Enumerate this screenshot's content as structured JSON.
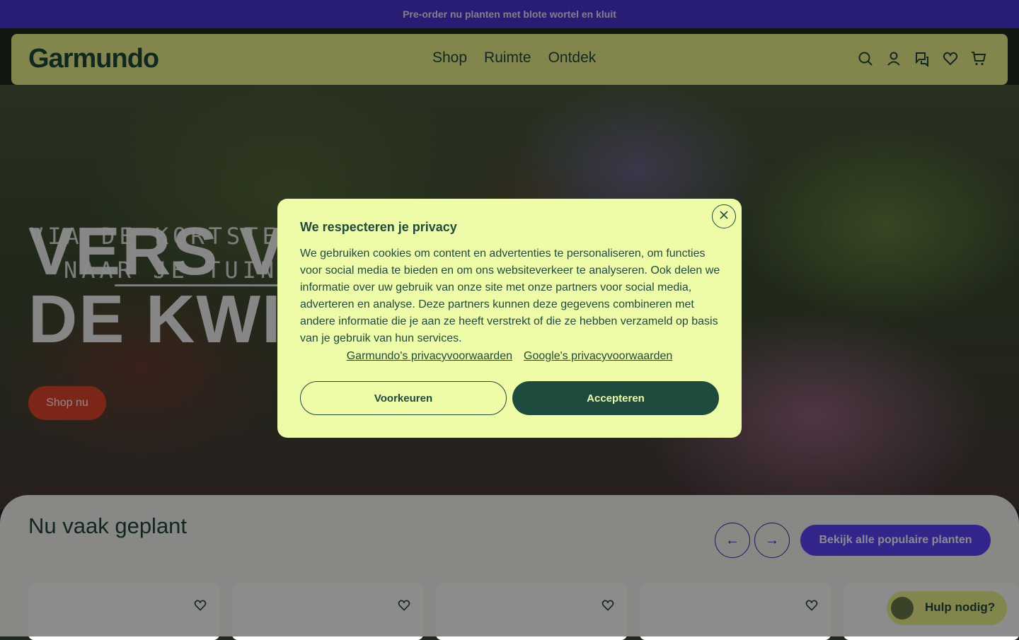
{
  "topbar": {
    "text": "Pre-order nu planten met blote wortel en kluit"
  },
  "header": {
    "logo": "Garmundo",
    "nav": [
      "Shop",
      "Ruimte",
      "Ontdek"
    ],
    "icons": [
      "search-icon",
      "account-icon",
      "chat-icon",
      "heart-icon",
      "cart-icon"
    ]
  },
  "hero": {
    "tagline_line1": "VIA DE KORTSTE WEG",
    "tagline_line2": "NAAR JE TUIN",
    "headline_line1": "VERS V",
    "headline_line2": "DE KWI",
    "cta": "Shop nu"
  },
  "section": {
    "title": "Nu vaak geplant",
    "prev_icon": "arrow-left-icon",
    "next_icon": "arrow-right-icon",
    "all_button": "Bekijk alle populaire planten"
  },
  "help": {
    "label": "Hulp nodig?"
  },
  "modal": {
    "title": "We respecteren je privacy",
    "body": "We gebruiken cookies om content en advertenties te personaliseren, om functies voor social media te bieden en om ons websiteverkeer te analyseren. Ook delen we informatie over uw gebruik van onze site met onze partners voor social media, adverteren en analyse. Deze partners kunnen deze gegevens combineren met andere informatie die je aan ze heeft verstrekt of die ze hebben verzameld op basis van je gebruik van hun services.",
    "link1": "Garmundo's privacyvoorwaarden",
    "link2": "Google's privacyvoorwaarden",
    "btn_preferences": "Voorkeuren",
    "btn_accept": "Accepteren"
  },
  "colors": {
    "topbar": "#4a36d6",
    "header": "#eef58a",
    "brand_dark": "#1f4a3e",
    "modal_bg": "#eefca8",
    "cta_red": "#e0452b",
    "accent_purple": "#5b45ff"
  }
}
